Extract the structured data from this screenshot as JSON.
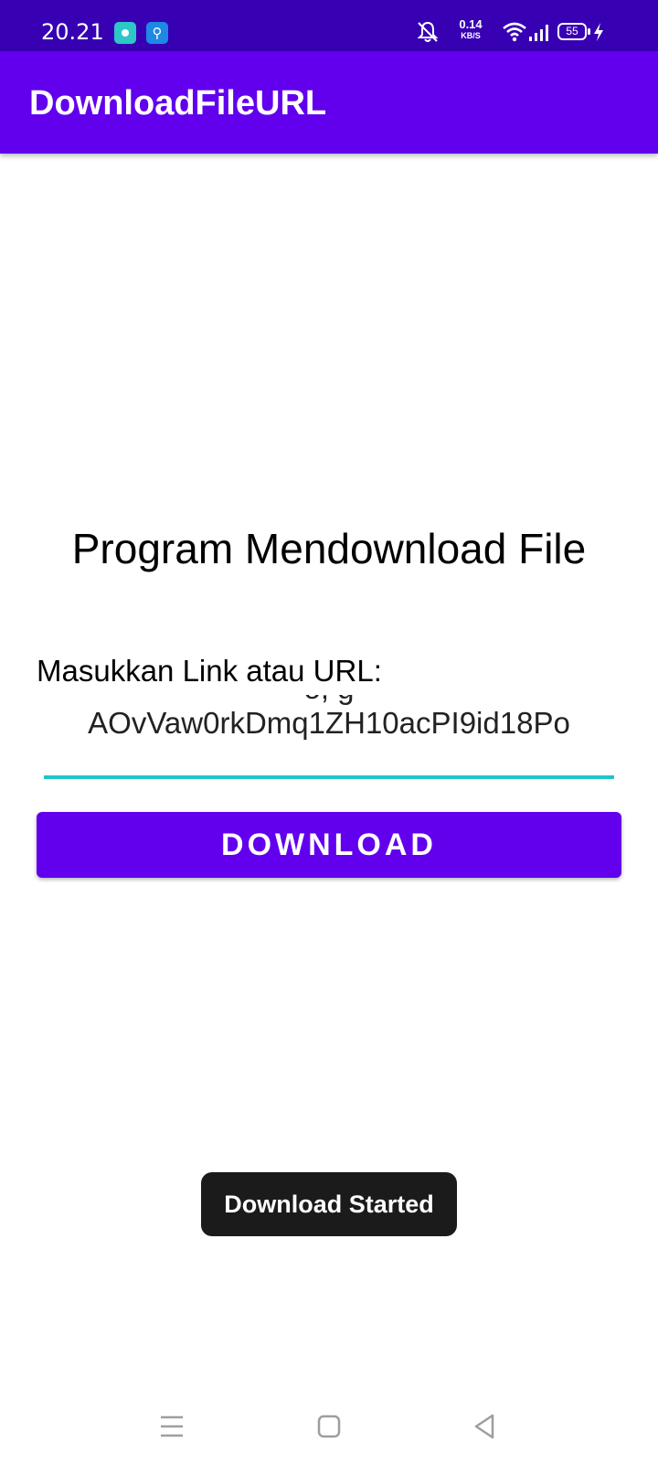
{
  "status_bar": {
    "time": "20.21",
    "net_speed_value": "0.14",
    "net_speed_unit": "KB/S",
    "battery_level": "55",
    "icons": [
      "app-notification-icon",
      "usb-icon",
      "silent-bell-icon",
      "wifi-icon",
      "signal-icon",
      "battery-icon",
      "charging-bolt-icon"
    ]
  },
  "app_bar": {
    "title": "DownloadFileURL"
  },
  "main": {
    "heading": "Program Mendownload File",
    "field_label": "Masukkan Link atau URL:",
    "url_partial_line": "o, g",
    "url_value": "AOvVaw0rkDmq1ZH10acPI9id18Po",
    "download_label": "DOWNLOAD"
  },
  "toast": {
    "message": "Download Started"
  },
  "colors": {
    "status_bar": "#3700b3",
    "primary": "#6200ee",
    "input_accent": "#1ec6c6",
    "toast_bg": "#1b1b1b"
  }
}
